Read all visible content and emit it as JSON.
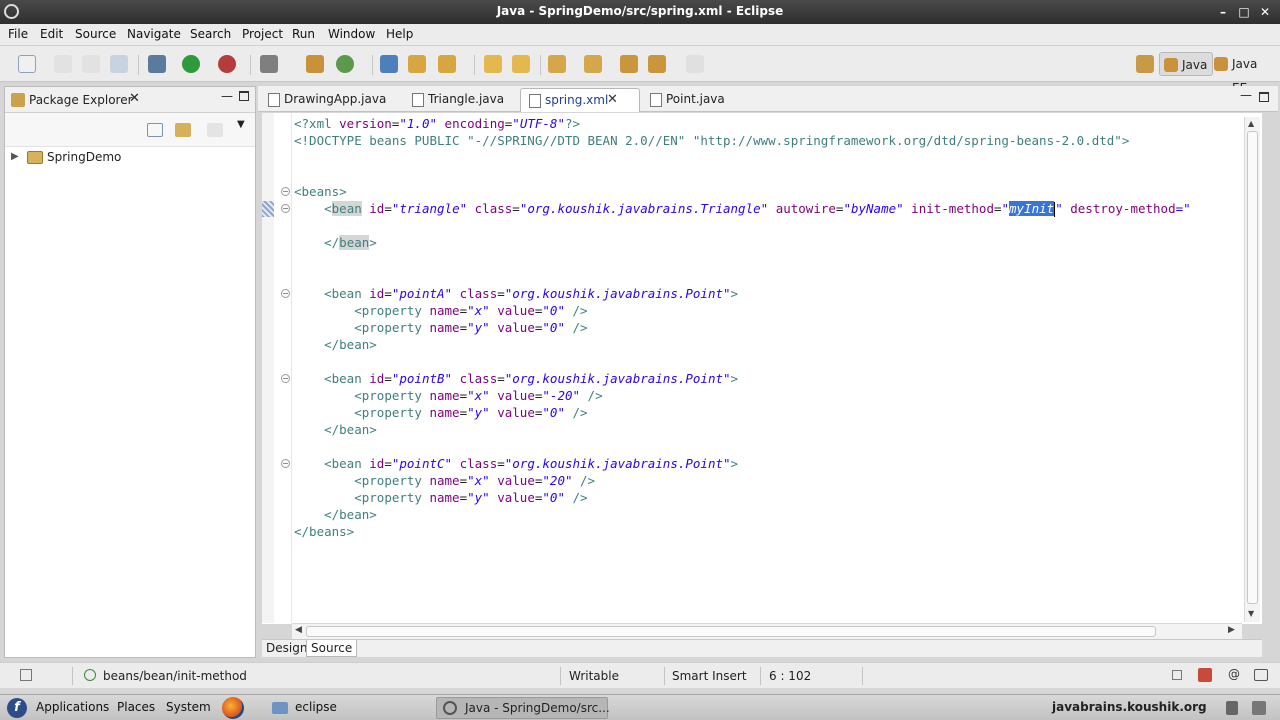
{
  "window": {
    "title": "Java - SpringDemo/src/spring.xml - Eclipse",
    "min": "–",
    "max": "□",
    "close": "✕"
  },
  "menu": [
    "File",
    "Edit",
    "Source",
    "Navigate",
    "Search",
    "Project",
    "Run",
    "Window",
    "Help"
  ],
  "perspectives": {
    "java": "Java",
    "javaee": "Java EE"
  },
  "package_explorer": {
    "title": "Package Explorer",
    "project": "SpringDemo"
  },
  "editor_tabs": [
    {
      "label": "DrawingApp.java"
    },
    {
      "label": "Triangle.java"
    },
    {
      "label": "spring.xml"
    },
    {
      "label": "Point.java"
    }
  ],
  "code": {
    "l1_a": "<?xml ",
    "l1_b": "version",
    "l1_c": "=",
    "l1_d": "\"1.0\"",
    "l1_e": " ",
    "l1_f": "encoding",
    "l1_g": "=",
    "l1_h": "\"UTF-8\"",
    "l1_i": "?>",
    "l2": "<!DOCTYPE beans PUBLIC \"-//SPRING//DTD BEAN 2.0//EN\" \"http://www.springframework.org/dtd/spring-beans-2.0.dtd\">",
    "beans_open": "<beans>",
    "beans_close": "</beans>",
    "triangle": {
      "open": "<",
      "bean": "bean",
      "id_attr": " id",
      "id_val": "\"triangle\"",
      "class_attr": " class",
      "class_val": "\"org.koushik.javabrains.Triangle\"",
      "autowire_attr": " autowire",
      "autowire_val": "\"byName\"",
      "init_attr": " init-method",
      "init_q": "\"",
      "init_val": "myInit",
      "init_q2": "\"",
      "destroy_attr": " destroy-method",
      "destroy_val": "=\"",
      "close_a": "</",
      "close_b": "bean",
      "close_c": ">"
    },
    "points": [
      {
        "id": "\"pointA\"",
        "x": "\"0\"",
        "y": "\"0\""
      },
      {
        "id": "\"pointB\"",
        "x": "\"-20\"",
        "y": "\"0\""
      },
      {
        "id": "\"pointC\"",
        "x": "\"20\"",
        "y": "\"0\""
      }
    ],
    "bean_tag": "<bean",
    "id_attr": " id",
    "eq": "=",
    "class_attr": " class",
    "point_class": "\"org.koushik.javabrains.Point\"",
    "gt": ">",
    "prop_tag": "<property",
    "name_attr": " name",
    "x_name": "\"x\"",
    "y_name": "\"y\"",
    "value_attr": " value",
    "selfclose": " />",
    "bean_close": "</bean>"
  },
  "bottom_tabs": {
    "design": "Design",
    "source": "Source"
  },
  "status": {
    "path": "beans/bean/init-method",
    "writable": "Writable",
    "insert": "Smart Insert",
    "position": "6 : 102"
  },
  "taskbar": {
    "applications": "Applications",
    "places": "Places",
    "system": "System",
    "eclipse": "eclipse",
    "window_button": "Java - SpringDemo/src...",
    "site": "javabrains.koushik.org"
  },
  "icons": [
    "eclipse-icon",
    "folder-icon",
    "firefox-icon",
    "java-file-icon",
    "xml-file-icon",
    "close-icon",
    "minimize-icon",
    "maximize-icon"
  ]
}
